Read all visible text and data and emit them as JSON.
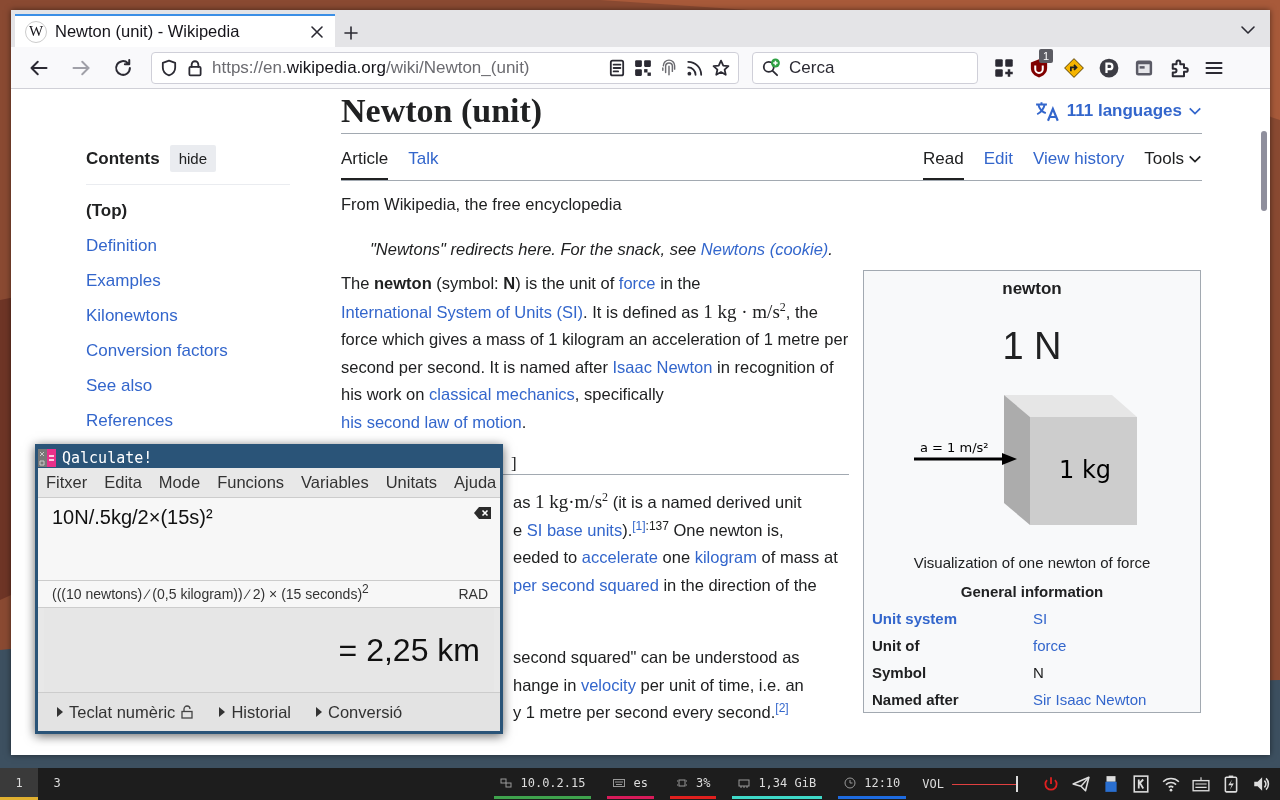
{
  "browser": {
    "tabs": [
      {
        "icon_letter": "W",
        "title": "Newton (unit) - Wikipedia",
        "selected": true
      }
    ],
    "url_parts": [
      {
        "text": "https://en.",
        "highlight": false
      },
      {
        "text": "wikipedia.org",
        "highlight": true
      },
      {
        "text": "/wiki/Newton_(unit)",
        "highlight": false
      }
    ],
    "search": {
      "placeholder": "Cerca"
    },
    "extension_badge": "1"
  },
  "page": {
    "title": "Newton (unit)",
    "languages": "111 languages",
    "namespace_tabs": [
      {
        "label": "Article",
        "selected": true
      },
      {
        "label": "Talk",
        "selected": false
      }
    ],
    "view_tabs": [
      {
        "label": "Read",
        "selected": true,
        "kind": "link"
      },
      {
        "label": "Edit",
        "selected": false,
        "kind": "link"
      },
      {
        "label": "View history",
        "selected": false,
        "kind": "link"
      },
      {
        "label": "Tools",
        "selected": false,
        "kind": "menu"
      }
    ],
    "toc": {
      "title": "Contents",
      "hide_button": "hide",
      "items": [
        {
          "label": "(Top)",
          "selected": true
        },
        {
          "label": "Definition",
          "selected": false
        },
        {
          "label": "Examples",
          "selected": false
        },
        {
          "label": "Kilonewtons",
          "selected": false
        },
        {
          "label": "Conversion factors",
          "selected": false
        },
        {
          "label": "See also",
          "selected": false
        },
        {
          "label": "References",
          "selected": false
        }
      ]
    },
    "tagline": "From Wikipedia, the free encyclopedia",
    "hatnote": [
      {
        "kind": "text",
        "text": "\"Newtons\" redirects here. For the snack, see "
      },
      {
        "kind": "link",
        "text": "Newtons (cookie)"
      },
      {
        "kind": "text",
        "text": "."
      }
    ],
    "lead": [
      {
        "kind": "text",
        "text": "The "
      },
      {
        "kind": "bold",
        "text": "newton"
      },
      {
        "kind": "text",
        "text": " (symbol: "
      },
      {
        "kind": "bold",
        "text": "N"
      },
      {
        "kind": "text",
        "text": ") is the unit of "
      },
      {
        "kind": "link",
        "text": "force"
      },
      {
        "kind": "text",
        "text": " in the "
      },
      {
        "kind": "link",
        "text": "International System of Units (SI)"
      },
      {
        "kind": "text",
        "text": ". It is defined as "
      },
      {
        "kind": "math",
        "text": "1 kg · m/s$^{2}$"
      },
      {
        "kind": "text",
        "text": ", the force which gives a mass of 1 kilogram an acceleration of 1 metre per second per second. It is named after "
      },
      {
        "kind": "link",
        "text": "Isaac Newton"
      },
      {
        "kind": "text",
        "text": " in recognition of his work on "
      },
      {
        "kind": "link",
        "text": "classical mechanics"
      },
      {
        "kind": "text",
        "text": ", specifically "
      },
      {
        "kind": "link",
        "text": "his second law of motion"
      },
      {
        "kind": "text",
        "text": "."
      }
    ],
    "heading_fragment": "]",
    "covered_paragraphs": [
      [
        [
          {
            "kind": "text",
            "text": "as "
          },
          {
            "kind": "math",
            "text": "1 kg·m/s$^{2}$"
          },
          {
            "kind": "text",
            "text": " (it is a named derived unit"
          }
        ],
        [
          {
            "kind": "text",
            "text": "e "
          },
          {
            "kind": "link",
            "text": "SI base units"
          },
          {
            "kind": "text",
            "text": ")."
          },
          {
            "kind": "ref",
            "text": "[1]"
          },
          {
            "kind": "sup",
            "text": ":137"
          },
          {
            "kind": "text",
            "text": " One newton is,"
          }
        ],
        [
          {
            "kind": "text",
            "text": "eeded to "
          },
          {
            "kind": "link",
            "text": "accelerate"
          },
          {
            "kind": "text",
            "text": " one "
          },
          {
            "kind": "link",
            "text": "kilogram"
          },
          {
            "kind": "text",
            "text": " of mass at"
          }
        ],
        [
          {
            "kind": "link",
            "text": "per second squared"
          },
          {
            "kind": "text",
            "text": " in the direction of the"
          }
        ]
      ],
      [
        [
          {
            "kind": "text",
            "text": "second squared\" can be understood as"
          }
        ],
        [
          {
            "kind": "text",
            "text": "hange in "
          },
          {
            "kind": "link",
            "text": "velocity"
          },
          {
            "kind": "text",
            "text": " per unit of time, i.e. an"
          }
        ],
        [
          {
            "kind": "text",
            "text": "y 1 metre per second every second."
          },
          {
            "kind": "ref",
            "text": "[2]"
          }
        ]
      ]
    ],
    "infobox": {
      "title": "newton",
      "symbol_large": "1 N",
      "diagram_arrow_label": "a = 1 m/s²",
      "diagram_mass_label": "1 kg",
      "caption": "Visualization of one newton of force",
      "section": "General information",
      "rows": [
        {
          "label": "Unit system",
          "label_link": true,
          "value": "SI",
          "value_link": true
        },
        {
          "label": "Unit of",
          "label_link": false,
          "value": "force",
          "value_link": true
        },
        {
          "label": "Symbol",
          "label_link": false,
          "value": "N",
          "value_link": false
        },
        {
          "label": "Named after",
          "label_link": false,
          "value": "Sir Isaac Newton",
          "value_link": true
        }
      ]
    }
  },
  "calculator": {
    "title": "Qalculate!",
    "menu": [
      "Fitxer",
      "Edita",
      "Mode",
      "Funcions",
      "Variables",
      "Unitats",
      "Ajuda"
    ],
    "expression": "10N/.5kg/2×(15s)²",
    "parsed": "(((10 newtons) ∕ (0,5 kilogram)) ∕ 2) × (15 seconds)$^{2}$",
    "angle_mode": "RAD",
    "result": "= 2,25 km",
    "expanders": [
      {
        "label": "Teclat numèric",
        "expanded": false,
        "locked": true
      },
      {
        "label": "Historial",
        "expanded": false,
        "locked": false
      },
      {
        "label": "Conversió",
        "expanded": false,
        "locked": false
      }
    ]
  },
  "taskbar": {
    "workspaces": [
      {
        "label": "1",
        "selected": true
      },
      {
        "label": "3",
        "selected": false
      }
    ],
    "status": [
      {
        "kind": "network",
        "text": "10.0.2.15",
        "color": "#3fa34d"
      },
      {
        "kind": "keyboard",
        "text": "es",
        "color": "#d81b5a"
      },
      {
        "kind": "cpu",
        "text": "3%",
        "color": "#e0201e"
      },
      {
        "kind": "memory",
        "text": "1,34 GiB",
        "color": "#3fd9c8"
      },
      {
        "kind": "clock",
        "text": "12:10",
        "color": "#1e6be0"
      }
    ],
    "volume": {
      "label": "VOL",
      "level": 1
    }
  }
}
